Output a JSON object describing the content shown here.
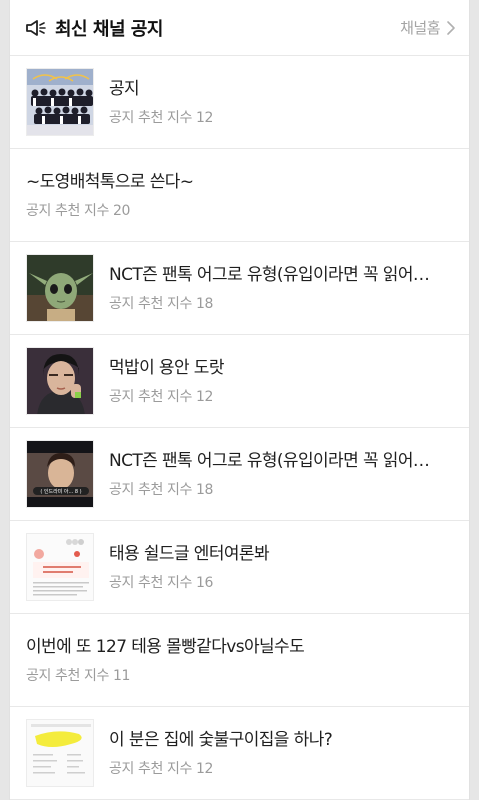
{
  "header": {
    "icon": "megaphone-icon",
    "title": "최신 채널 공지",
    "home_label": "채널홈",
    "home_icon": "chevron-right-icon"
  },
  "posts": [
    {
      "title": "공지",
      "meta_label": "공지 추천 지수",
      "score": "12",
      "thumbnail": "group-photo"
    },
    {
      "title": "~도영배척톡으로 쓴다~",
      "meta_label": "공지 추천 지수",
      "score": "20",
      "thumbnail": ""
    },
    {
      "title": "NCT즌 팬톡 어그로 유형(유입이라면 꼭 읽어…",
      "meta_label": "공지 추천 지수",
      "score": "18",
      "thumbnail": "alien-photo"
    },
    {
      "title": "먹밥이 용안 도랏",
      "meta_label": "공지 추천 지수",
      "score": "12",
      "thumbnail": "portrait-photo"
    },
    {
      "title": "NCT즌 팬톡 어그로 유형(유입이라면 꼭 읽어…",
      "meta_label": "공지 추천 지수",
      "score": "18",
      "thumbnail": "video-still",
      "thumb_caption": "( 인드라미 아... 8 )"
    },
    {
      "title": "태용 쉴드글 엔터여론봐",
      "meta_label": "공지 추천 지수",
      "score": "16",
      "thumbnail": "document-screenshot"
    },
    {
      "title": "이번에 또 127 테용 몰빵같다vs아닐수도",
      "meta_label": "공지 추천 지수",
      "score": "11",
      "thumbnail": ""
    },
    {
      "title": "이 분은 집에 숯불구이집을 하나?",
      "meta_label": "공지 추천 지수",
      "score": "12",
      "thumbnail": "redacted-screenshot"
    }
  ]
}
